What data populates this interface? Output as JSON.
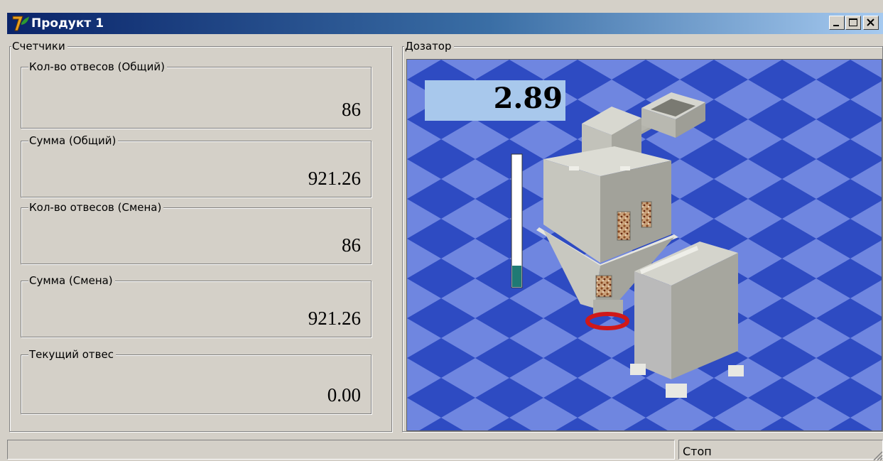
{
  "window": {
    "title": "Продукт 1"
  },
  "counters": {
    "group_label": "Счетчики",
    "items": [
      {
        "label": "Кол-во отвесов (Общий)",
        "value": "86"
      },
      {
        "label": "Сумма (Общий)",
        "value": "921.26"
      },
      {
        "label": "Кол-во отвесов (Смена)",
        "value": "86"
      },
      {
        "label": "Сумма (Смена)",
        "value": "921.26"
      },
      {
        "label": "Текущий отвес",
        "value": "0.00"
      }
    ]
  },
  "dispenser": {
    "group_label": "Дозатор",
    "weight_display": "2.89",
    "level_fraction": 0.16,
    "level_color": "#1f7a74"
  },
  "statusbar": {
    "state": "Стоп"
  },
  "colors": {
    "titlebar_start": "#0a246a",
    "floor_light": "#6f86e0",
    "floor_dark": "#2e4bc2",
    "machine": "#bcbcb4"
  },
  "icons": [
    "app-icon",
    "minimize-icon",
    "maximize-icon",
    "close-icon",
    "size-grip-icon"
  ]
}
